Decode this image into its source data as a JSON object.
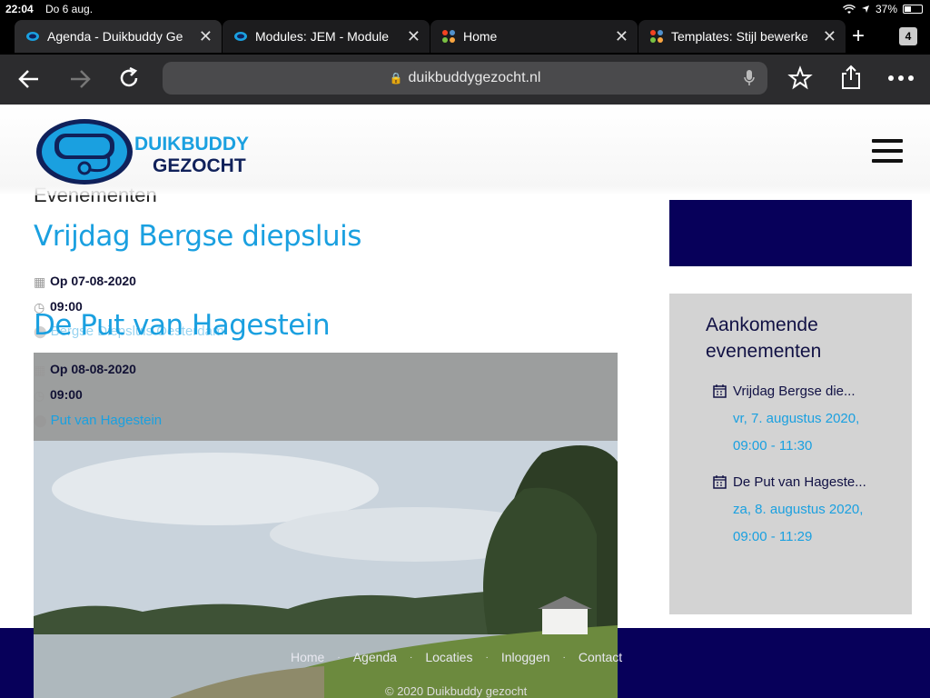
{
  "status": {
    "time": "22:04",
    "date": "Do 6 aug.",
    "battery": "37%"
  },
  "tabs": [
    {
      "label": "Agenda - Duikbuddy Gezocht"
    },
    {
      "label": "Modules: JEM - Module"
    },
    {
      "label": "Home"
    },
    {
      "label": "Templates: Stijl bewerken"
    }
  ],
  "tab_count": "4",
  "url": "duikbuddygezocht.nl",
  "site": {
    "logo_line1": "DUIKBUDDY",
    "logo_line2": "GEZOCHT"
  },
  "main": {
    "heading": "Evenementen",
    "events": [
      {
        "title": "Vrijdag Bergse diepsluis",
        "date": "Op 07-08-2020",
        "time": "09:00",
        "location": "Bergse Diepsluis Oesterdam"
      },
      {
        "title": "De Put van Hagestein",
        "date": "Op 08-08-2020",
        "time": "09:00",
        "location": "Put van Hagestein"
      }
    ]
  },
  "sidebar": {
    "title": "Aankomende evenementen",
    "events": [
      {
        "title": "Vrijdag Bergse die...",
        "date": "vr, 7. augustus 2020,",
        "time": "09:00 - 11:30"
      },
      {
        "title": "De Put van Hageste...",
        "date": "za, 8. augustus 2020,",
        "time": "09:00 - 11:29"
      }
    ]
  },
  "footer": {
    "nav": [
      "Home",
      "Agenda",
      "Locaties",
      "Inloggen",
      "Contact"
    ],
    "copyright": "© 2020 Duikbuddy gezocht"
  },
  "colors": {
    "accent": "#1aa0e0",
    "navy": "#07005a",
    "sidebar_bg": "#d3d3d3"
  }
}
